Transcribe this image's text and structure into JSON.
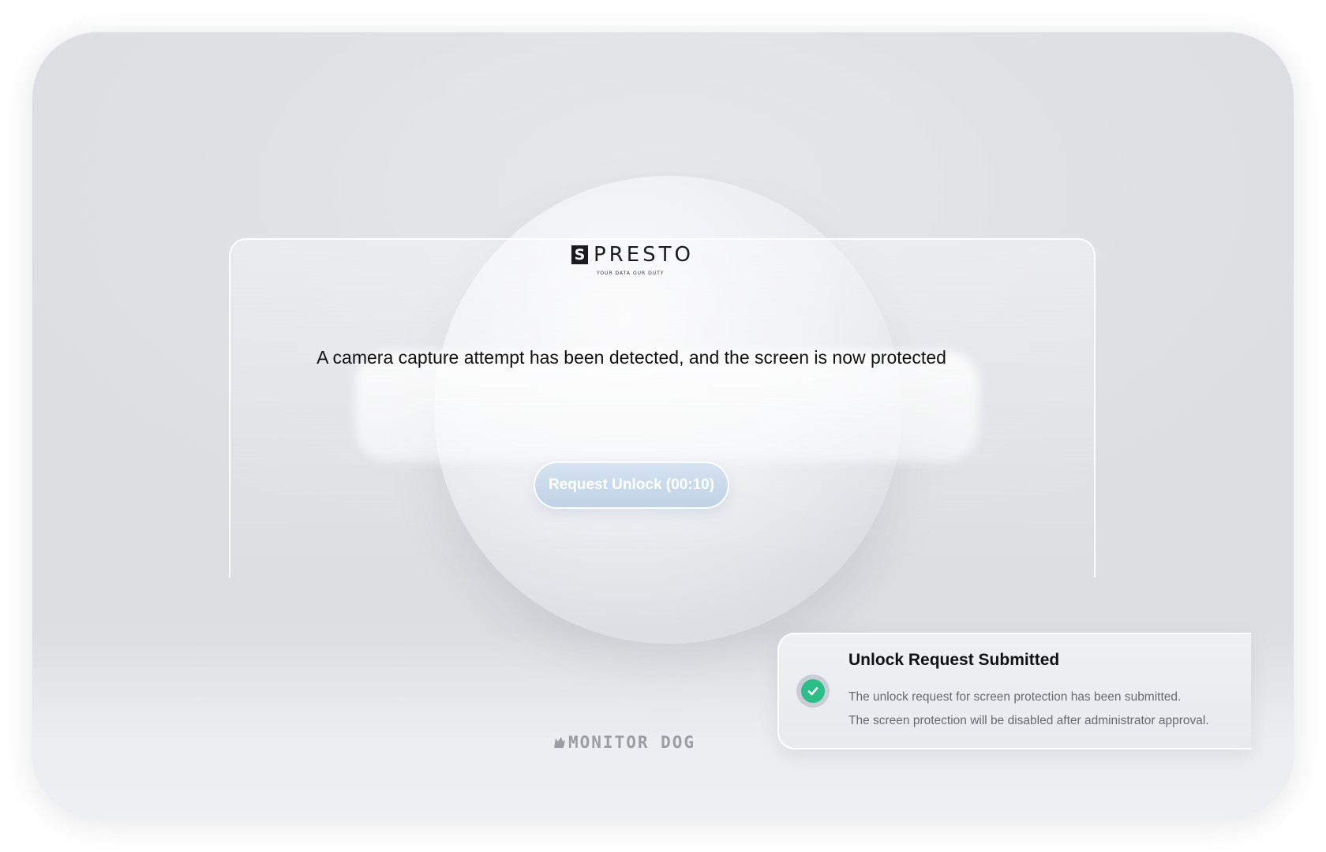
{
  "logo": {
    "mark": "S",
    "word": "PRESTO",
    "tagline": "YOUR DATA OUR DUTY"
  },
  "lock_screen": {
    "message": "A camera capture attempt has been detected, and the screen is now protected",
    "unlock_button_label": "Request Unlock (00:10)"
  },
  "footer": {
    "brand": "MONITOR DOG"
  },
  "toast": {
    "title": "Unlock Request Submitted",
    "line1": "The unlock request for screen protection has been submitted.",
    "line2": "The screen protection will be disabled after administrator approval.",
    "icon": "check-circle-icon",
    "status_color": "#2bbf87"
  },
  "colors": {
    "button": "#c8d9eb",
    "background": "#e0e2e6"
  }
}
